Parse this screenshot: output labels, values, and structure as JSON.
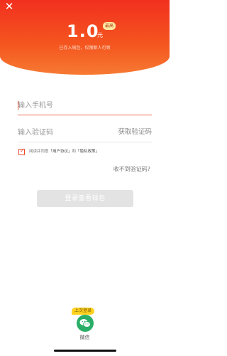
{
  "header": {
    "close_icon": "close-icon",
    "amount": "1.0",
    "unit": "元",
    "badge": "最高",
    "subtitle": "已存入钱包，仅限新人可领"
  },
  "form": {
    "phone_placeholder": "输入手机号",
    "code_placeholder": "输入验证码",
    "get_code_label": "获取验证码",
    "agreement": {
      "checked": true,
      "prefix": "阅读并同意",
      "user_agreement": "「用户协议」",
      "and": "和",
      "privacy_policy": "「隐私政策」"
    },
    "no_code_label": "收不到验证码?",
    "login_button": "登录查看钱包"
  },
  "third_party": {
    "last_login_badge": "上次登录",
    "wechat_icon": "wechat-icon",
    "wechat_label": "微信"
  },
  "colors": {
    "brand_red": "#f2301f",
    "accent_orange": "#f06a4c",
    "wechat_green": "#2aae67",
    "badge_yellow": "#ffd21f"
  }
}
